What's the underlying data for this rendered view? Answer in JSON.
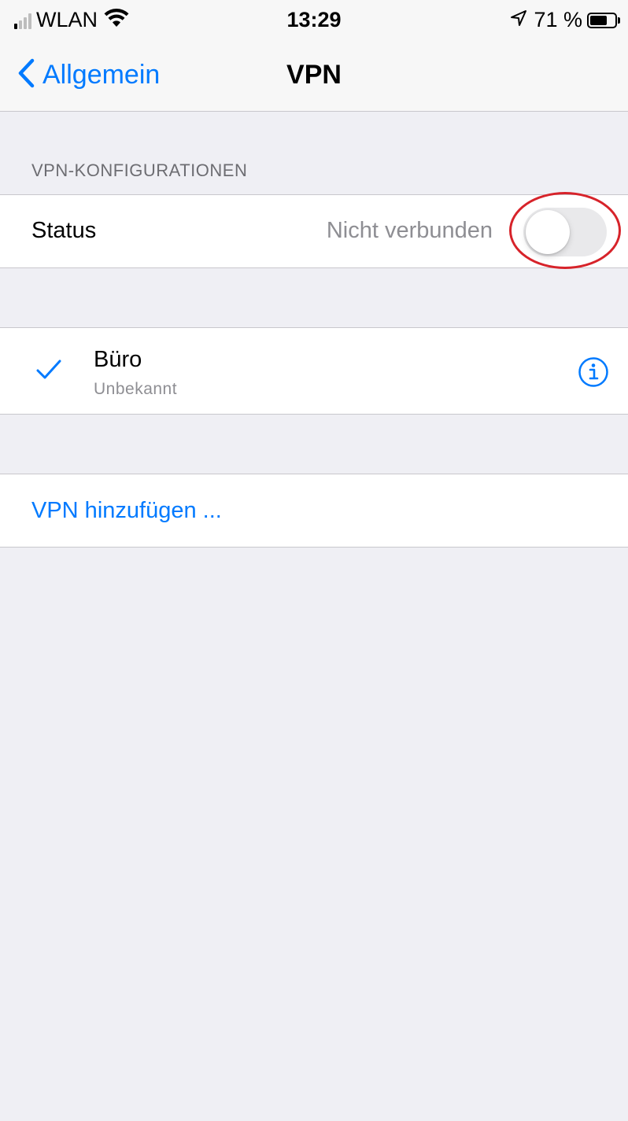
{
  "status_bar": {
    "carrier": "WLAN",
    "time": "13:29",
    "battery_percent_label": "71 %",
    "battery_level": 0.71,
    "signal_bars_active": 1,
    "signal_bars_total": 4
  },
  "nav": {
    "back_label": "Allgemein",
    "title": "VPN"
  },
  "section": {
    "header": "VPN-KONFIGURATIONEN"
  },
  "status_row": {
    "label": "Status",
    "value": "Nicht verbunden",
    "toggle_on": false
  },
  "vpn_list": [
    {
      "name": "Büro",
      "subtitle": "Unbekannt",
      "selected": true
    }
  ],
  "add_vpn": {
    "label": "VPN hinzufügen ..."
  },
  "colors": {
    "accent": "#007aff",
    "background": "#efeff4",
    "toggle_off": "#e9e9eb",
    "highlight": "#d7232a"
  },
  "icons": {
    "signal": "cellular-signal-icon",
    "wifi": "wifi-icon",
    "location": "location-arrow-icon",
    "battery": "battery-icon",
    "back": "chevron-left-icon",
    "check": "checkmark-icon",
    "info": "info-circle-icon"
  }
}
